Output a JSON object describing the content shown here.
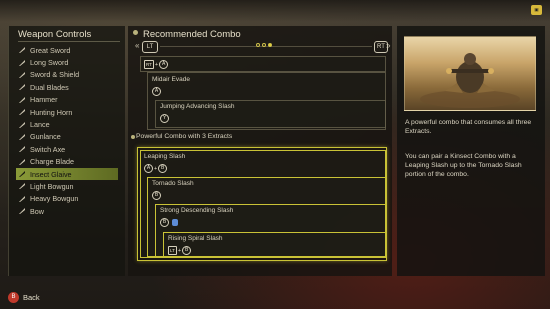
{
  "left": {
    "title": "Weapon Controls",
    "items": [
      {
        "label": "Great Sword",
        "icon": "great-sword-icon"
      },
      {
        "label": "Long Sword",
        "icon": "long-sword-icon"
      },
      {
        "label": "Sword & Shield",
        "icon": "sword-shield-icon"
      },
      {
        "label": "Dual Blades",
        "icon": "dual-blades-icon"
      },
      {
        "label": "Hammer",
        "icon": "hammer-icon"
      },
      {
        "label": "Hunting Horn",
        "icon": "hunting-horn-icon"
      },
      {
        "label": "Lance",
        "icon": "lance-icon"
      },
      {
        "label": "Gunlance",
        "icon": "gunlance-icon"
      },
      {
        "label": "Switch Axe",
        "icon": "switch-axe-icon"
      },
      {
        "label": "Charge Blade",
        "icon": "charge-blade-icon"
      },
      {
        "label": "Insect Glaive",
        "icon": "insect-glaive-icon",
        "selected": true
      },
      {
        "label": "Light Bowgun",
        "icon": "light-bowgun-icon"
      },
      {
        "label": "Heavy Bowgun",
        "icon": "heavy-bowgun-icon"
      },
      {
        "label": "Bow",
        "icon": "bow-icon"
      }
    ]
  },
  "middle": {
    "title": "Recommended Combo",
    "lt": "LT",
    "rt": "RT",
    "page_dots": 3,
    "page_active": 3,
    "top_combo": {
      "first_input": {
        "btn1": "RT",
        "plus": "+",
        "btn2": "A"
      },
      "steps": [
        {
          "label": "Midair Evade",
          "btn": "A"
        },
        {
          "label": "Jumping Advancing Slash",
          "btn": "Y"
        }
      ]
    },
    "section_title": "Powerful Combo with 3 Extracts",
    "combo": [
      {
        "label": "Leaping Slash",
        "btn1": "A",
        "plus": "+",
        "btn2": "B"
      },
      {
        "label": "Tornado Slash",
        "btn1": "B"
      },
      {
        "label": "Strong Descending Slash",
        "btn1": "B"
      },
      {
        "label": "Rising Spiral Slash",
        "btn1": "LT",
        "plus": "+",
        "btn2": "B"
      }
    ]
  },
  "right": {
    "desc1": "A powerful combo that consumes all three Extracts.",
    "desc2": "You can pair a Kinsect Combo with a Leaping Slash up to the Tornado Slash portion of the combo."
  },
  "footer": {
    "back_btn": "B",
    "back_label": "Back"
  },
  "colors": {
    "accent": "#c9c236",
    "selected": "#8a9a38",
    "back_button": "#c0392b"
  }
}
